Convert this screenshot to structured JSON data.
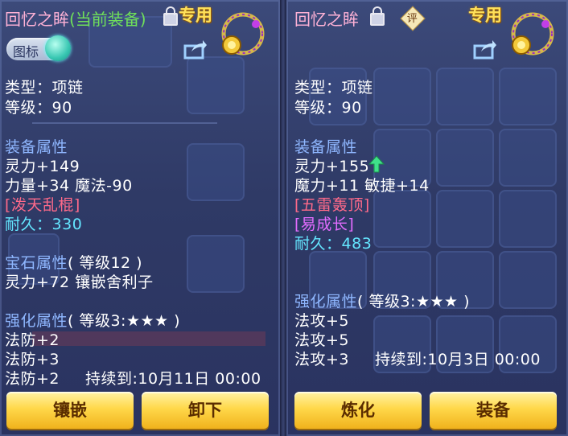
{
  "left": {
    "title": "回忆之眸",
    "title_sub": "(当前装备)",
    "exclusive": "专用",
    "toggle_label": "图标",
    "type": "类型：项链",
    "level": "等级：90",
    "equip_attr_header": "装备属性",
    "attr_line1": "灵力+149",
    "attr_line2": "力量+34 魔法-90",
    "special_skill": "[泼天乱棍]",
    "durability_label": "耐久：",
    "durability_value": "330",
    "gem_header": "宝石属性",
    "gem_level": "( 等级12 )",
    "gem_line": "灵力+72 镶嵌舍利子",
    "enhance_header": "强化属性",
    "enhance_level": "( 等级3:★★★ )",
    "enhance_lines": [
      "法防+2",
      "法防+3",
      "法防+2"
    ],
    "enhance_duration": "持续到:10月11日 00:00",
    "btn_left": "镶嵌",
    "btn_right": "卸下"
  },
  "right": {
    "title": "回忆之眸",
    "badge": "评",
    "exclusive": "专用",
    "type": "类型：项链",
    "level": "等级：90",
    "equip_attr_header": "装备属性",
    "attr_line1": "灵力+155",
    "attr_line2": "魔力+11 敏捷+14",
    "special_skill": "[五雷轰顶]",
    "special_effect": "[易成长]",
    "durability_label": "耐久：",
    "durability_value": "483",
    "enhance_header": "强化属性",
    "enhance_level": "( 等级3:★★★ )",
    "enhance_lines": [
      "法攻+5",
      "法攻+5",
      "法攻+3"
    ],
    "enhance_duration": "持续到:10月3日 00:00",
    "btn_left": "炼化",
    "btn_right": "装备"
  },
  "colors": {
    "title": "#ffb2d6",
    "title_sub": "#6fe05a",
    "exclusive": "#ffe15a",
    "header": "#8fb7ff",
    "special_red": "#ff6a8a",
    "special_pink": "#e36cff",
    "durability": "#64e6ff",
    "button": "#ffd84a"
  },
  "icons": [
    "lock-open-icon",
    "share-icon",
    "necklace-icon",
    "rating-badge-icon",
    "up-arrow-icon"
  ]
}
